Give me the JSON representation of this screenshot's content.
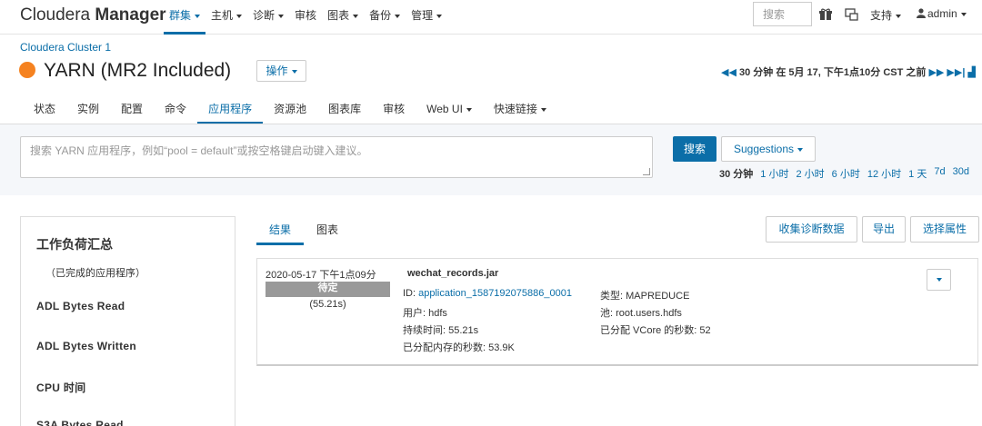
{
  "topbar": {
    "logo_light": "Cloudera ",
    "logo_bold": "Manager",
    "nav": [
      {
        "label": "群集",
        "caret": true,
        "active": true
      },
      {
        "label": "主机",
        "caret": true
      },
      {
        "label": "诊断",
        "caret": true
      },
      {
        "label": "审核",
        "caret": false
      },
      {
        "label": "图表",
        "caret": true
      },
      {
        "label": "备份",
        "caret": true
      },
      {
        "label": "管理",
        "caret": true
      }
    ],
    "search_placeholder": "搜索",
    "support": "支持",
    "user": "admin"
  },
  "header": {
    "breadcrumb": "Cloudera Cluster 1",
    "service_title": "YARN (MR2 Included)",
    "status_color": "#f58220",
    "actions_label": "操作",
    "time_marker": "30 分钟 在 5月 17, 下午1点10分 CST 之前"
  },
  "tabs": [
    {
      "label": "状态"
    },
    {
      "label": "实例"
    },
    {
      "label": "配置"
    },
    {
      "label": "命令"
    },
    {
      "label": "应用程序",
      "active": true
    },
    {
      "label": "资源池"
    },
    {
      "label": "图表库"
    },
    {
      "label": "审核"
    },
    {
      "label": "Web UI",
      "caret": true
    },
    {
      "label": "快速链接",
      "caret": true
    }
  ],
  "search": {
    "placeholder": "搜索 YARN 应用程序，例如“pool = default”或按空格键启动键入建议。",
    "search_button": "搜索",
    "suggestions_button": "Suggestions",
    "ranges": [
      "30 分钟",
      "1 小时",
      "2 小时",
      "6 小时",
      "12 小时",
      "1 天",
      "7d",
      "30d"
    ]
  },
  "sidebar": {
    "title": "工作负荷汇总",
    "subtitle": "（已完成的应用程序）",
    "items": [
      "ADL Bytes Read",
      "ADL Bytes Written",
      "CPU 时间",
      "S3A Bytes Read"
    ]
  },
  "results": {
    "tabs": [
      "结果",
      "图表"
    ],
    "buttons": [
      "收集诊断数据",
      "导出",
      "选择属性"
    ],
    "app": {
      "time": "2020-05-17 下午1点09分",
      "status": "待定",
      "duration_short": "(55.21s)",
      "name": "wechat_records.jar",
      "id_label": "ID:",
      "id_value": "application_1587192075886_0001",
      "user_label": "用户:",
      "user_value": "hdfs",
      "duration_label": "持续时间:",
      "duration_value": "55.21s",
      "memsec_label": "已分配内存的秒数:",
      "memsec_value": "53.9K",
      "type_label": "类型:",
      "type_value": "MAPREDUCE",
      "pool_label": "池:",
      "pool_value": "root.users.hdfs",
      "vcore_label": "已分配 VCore 的秒数:",
      "vcore_value": "52"
    }
  }
}
